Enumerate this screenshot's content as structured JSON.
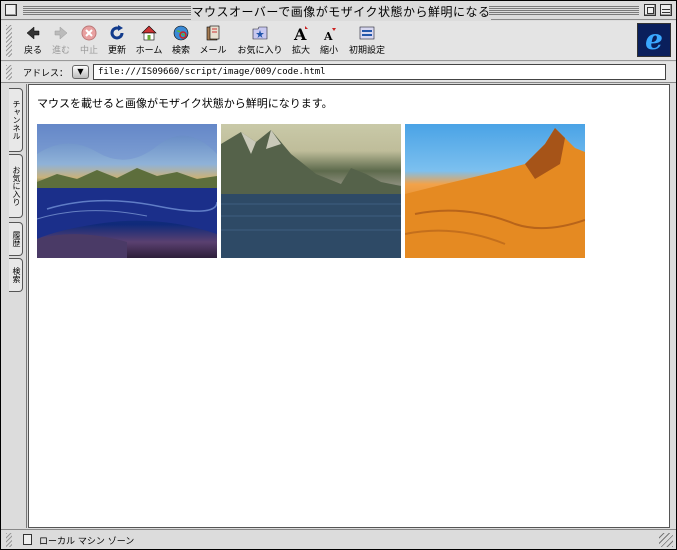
{
  "window": {
    "title": "マウスオーバーで画像がモザイク状態から鮮明になる"
  },
  "toolbar": {
    "buttons": [
      {
        "label": "戻る",
        "icon": "back-arrow-icon",
        "enabled": true
      },
      {
        "label": "進む",
        "icon": "forward-arrow-icon",
        "enabled": false
      },
      {
        "label": "中止",
        "icon": "stop-icon",
        "enabled": false
      },
      {
        "label": "更新",
        "icon": "refresh-icon",
        "enabled": true
      },
      {
        "label": "ホーム",
        "icon": "home-icon",
        "enabled": true
      },
      {
        "label": "検索",
        "icon": "search-globe-icon",
        "enabled": true
      },
      {
        "label": "メール",
        "icon": "mail-icon",
        "enabled": true
      },
      {
        "label": "お気に入り",
        "icon": "favorites-icon",
        "enabled": true
      },
      {
        "label": "拡大",
        "icon": "font-larger-icon",
        "enabled": true
      },
      {
        "label": "縮小",
        "icon": "font-smaller-icon",
        "enabled": true
      },
      {
        "label": "初期設定",
        "icon": "preferences-icon",
        "enabled": true
      }
    ]
  },
  "address": {
    "label": "アドレス：",
    "value": "file:///IS09660/script/image/009/code.html"
  },
  "sidetabs": [
    "チャンネル",
    "お気に入り",
    "履歴",
    "検索"
  ],
  "content": {
    "message": "マウスを載せると画像がモザイク状態から鮮明になります。",
    "images": [
      "ocean-coast-landscape-image",
      "lake-mountains-landscape-image",
      "desert-mountain-landscape-image"
    ]
  },
  "status": {
    "zone": "ローカル マシン ゾーン"
  },
  "colors": {
    "chrome": "#dcdcdc",
    "ie_logo_bg": "#0a1f5c",
    "ie_logo_fg": "#3aa8ff"
  }
}
